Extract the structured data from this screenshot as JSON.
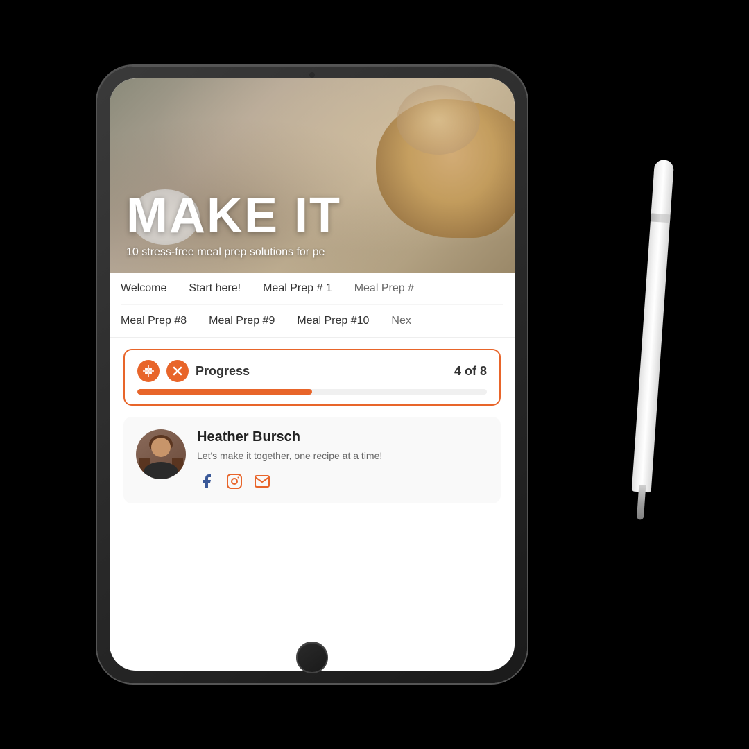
{
  "scene": {
    "background": "#000000"
  },
  "hero": {
    "title": "MAKE IT",
    "subtitle": "10 stress-free meal prep solutions for pe"
  },
  "navigation": {
    "row1": [
      {
        "label": "Welcome"
      },
      {
        "label": "Start here!"
      },
      {
        "label": "Meal Prep # 1"
      },
      {
        "label": "Meal Prep #"
      }
    ],
    "row2": [
      {
        "label": "Meal Prep #8"
      },
      {
        "label": "Meal Prep #9"
      },
      {
        "label": "Meal Prep #10"
      },
      {
        "label": "Nex"
      }
    ]
  },
  "progress": {
    "label": "Progress",
    "current": 4,
    "total": 8,
    "count_text": "4 of 8",
    "fill_percent": 50
  },
  "author": {
    "name": "Heather Bursch",
    "bio": "Let's make it together, one recipe at a time!",
    "social": {
      "facebook_label": "f",
      "instagram_label": "ig",
      "email_label": "✉"
    }
  },
  "icons": {
    "drag": "⊕",
    "close": "✕",
    "facebook": "f",
    "instagram": "◎",
    "email": "✉"
  }
}
